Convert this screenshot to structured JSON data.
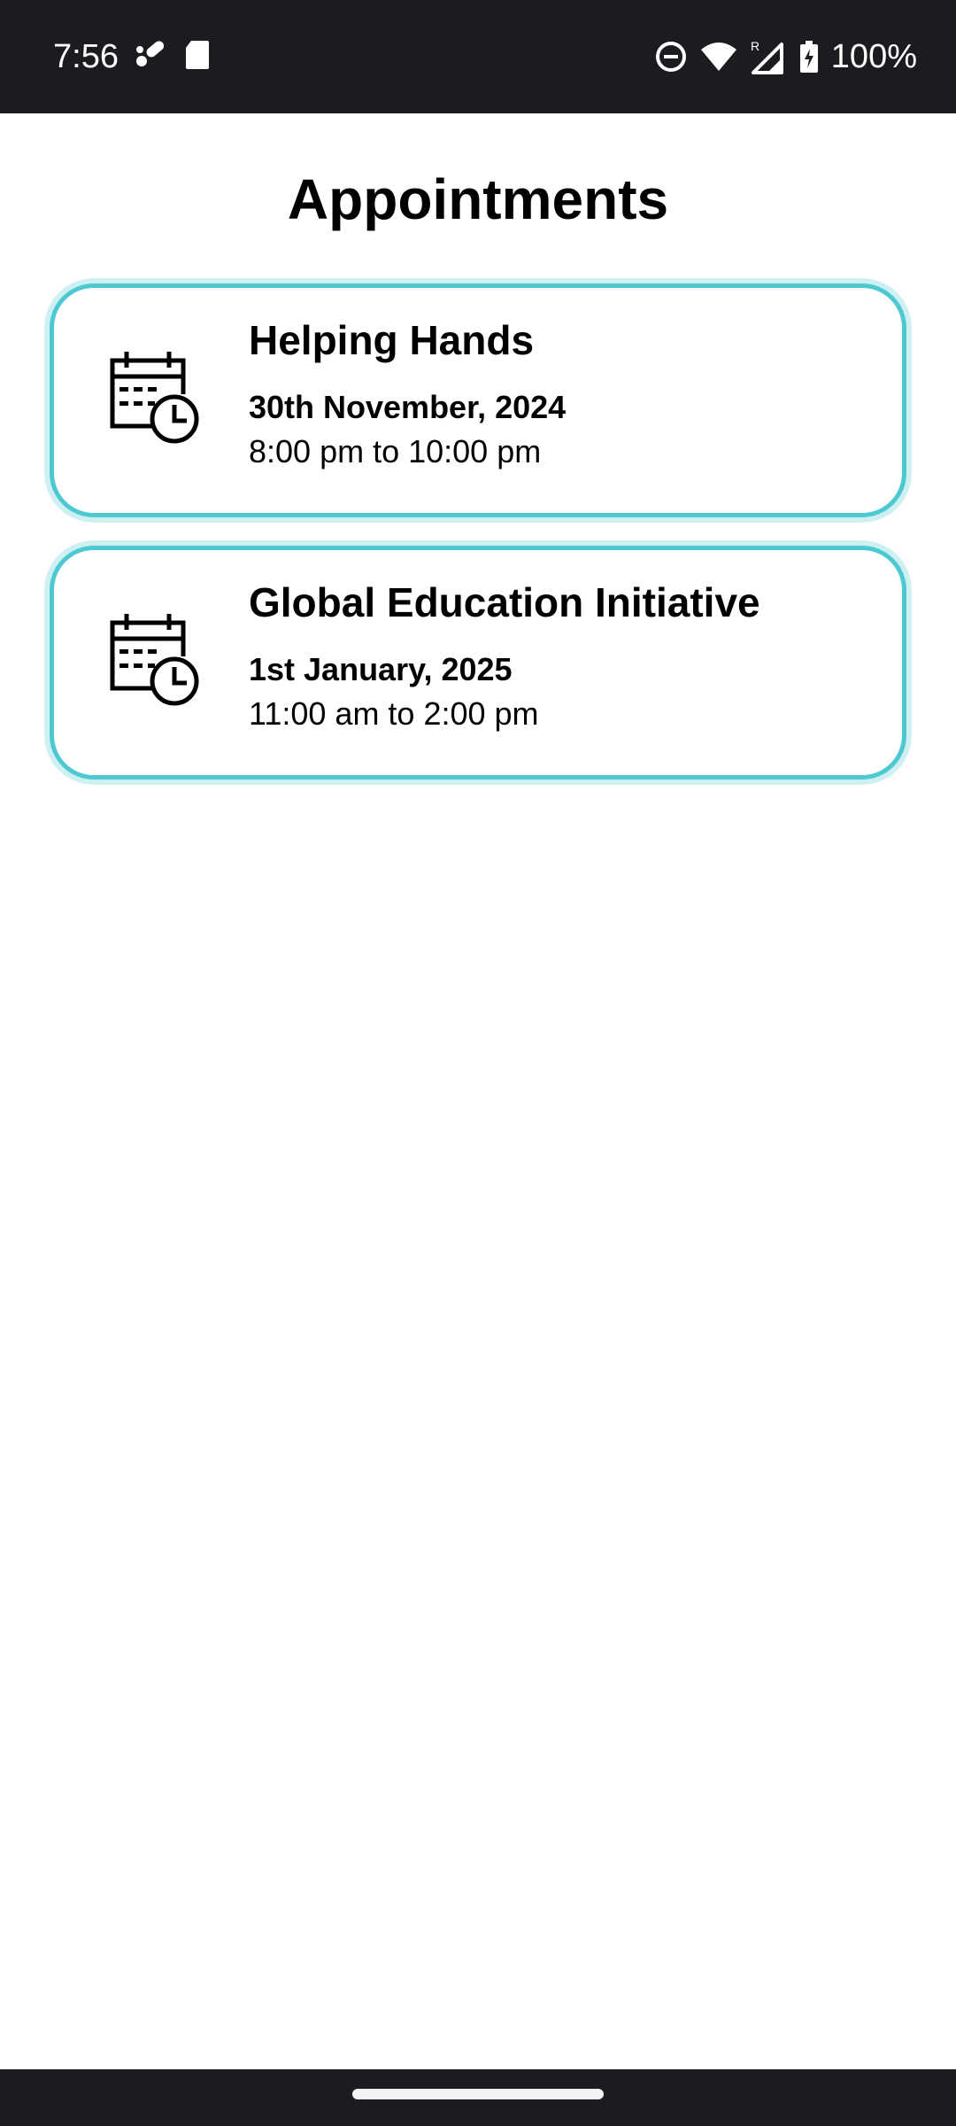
{
  "status_bar": {
    "time": "7:56",
    "battery": "100%",
    "icons": [
      "medication-icon",
      "sd-card-icon",
      "do-not-disturb-icon",
      "wifi-icon",
      "signal-roaming-icon",
      "battery-charging-icon"
    ],
    "roaming_indicator": "R"
  },
  "header": {
    "title": "Appointments"
  },
  "appointments": [
    {
      "title": "Helping Hands",
      "date": "30th November, 2024",
      "time": "8:00 pm to 10:00 pm",
      "icon": "calendar-clock-icon"
    },
    {
      "title": "Global Education Initiative",
      "date": "1st January, 2025",
      "time": "11:00 am to 2:00 pm",
      "icon": "calendar-clock-icon"
    }
  ],
  "colors": {
    "accent": "#4fc9d1",
    "status_bar_bg": "#1c1c20",
    "background": "#ffffff",
    "text": "#000000"
  }
}
